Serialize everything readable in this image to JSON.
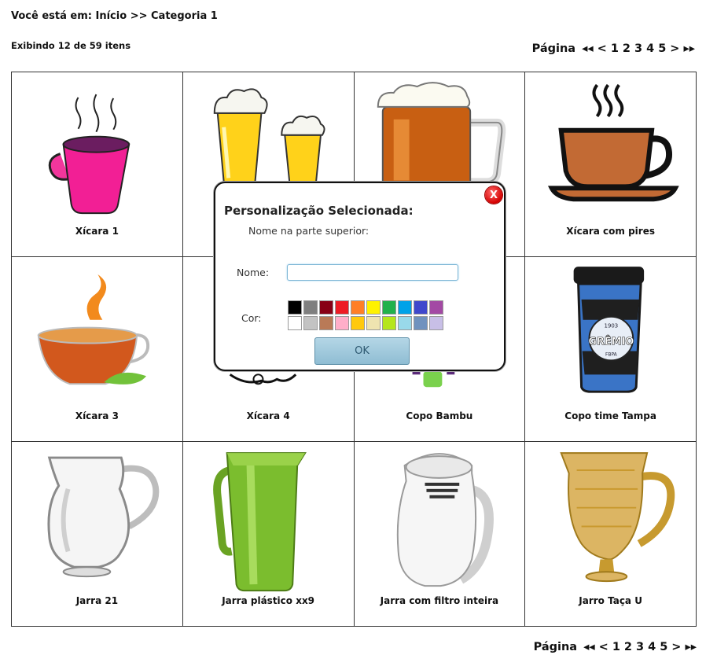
{
  "breadcrumb": {
    "prefix": "Você está em:",
    "home": "Início",
    "separator": ">>",
    "current": "Categoria 1"
  },
  "count_text": "Exibindo 12 de 59 itens",
  "pager": {
    "label": "Página",
    "first": "◂◂",
    "prev": "<",
    "pages": [
      "1",
      "2",
      "3",
      "4",
      "5"
    ],
    "next": ">",
    "last": "▸▸"
  },
  "products": [
    {
      "name": "Xícara 1",
      "icon": "pink-cup-icon"
    },
    {
      "name": "",
      "icon": "beer-glasses-icon"
    },
    {
      "name": "",
      "icon": "beer-mug-icon"
    },
    {
      "name": "Xícara com pires",
      "icon": "cup-saucer-icon"
    },
    {
      "name": "Xícara 3",
      "icon": "tea-cup-icon"
    },
    {
      "name": "Xícara 4",
      "icon": "cup-icon"
    },
    {
      "name": "Copo Bambu",
      "icon": "bamboo-cup-icon"
    },
    {
      "name": "Copo time Tampa",
      "icon": "team-tumbler-icon"
    },
    {
      "name": "Jarra 21",
      "icon": "glass-pitcher-icon"
    },
    {
      "name": "Jarra plástico xx9",
      "icon": "green-pitcher-icon"
    },
    {
      "name": "Jarra com filtro inteira",
      "icon": "filter-pitcher-icon"
    },
    {
      "name": "Jarro Taça U",
      "icon": "gold-pitcher-icon"
    }
  ],
  "tumbler_text": {
    "number": "1903",
    "brand": "GRÊMIO",
    "small": "FBPA"
  },
  "modal": {
    "title": "Personalização Selecionada:",
    "subtitle": "Nome na parte superior:",
    "name_label": "Nome:",
    "name_value": "",
    "color_label": "Cor:",
    "ok_label": "OK",
    "close_label": "X",
    "colors": [
      "#000000",
      "#7f7f7f",
      "#880015",
      "#ed1c24",
      "#ff7f27",
      "#fff200",
      "#22b14c",
      "#00a2e8",
      "#3f48cc",
      "#a349a4",
      "#ffffff",
      "#c3c3c3",
      "#b97a57",
      "#ffaec9",
      "#ffc90e",
      "#efe4b0",
      "#b5e61d",
      "#99d9ea",
      "#7092be",
      "#c8bfe7"
    ]
  }
}
